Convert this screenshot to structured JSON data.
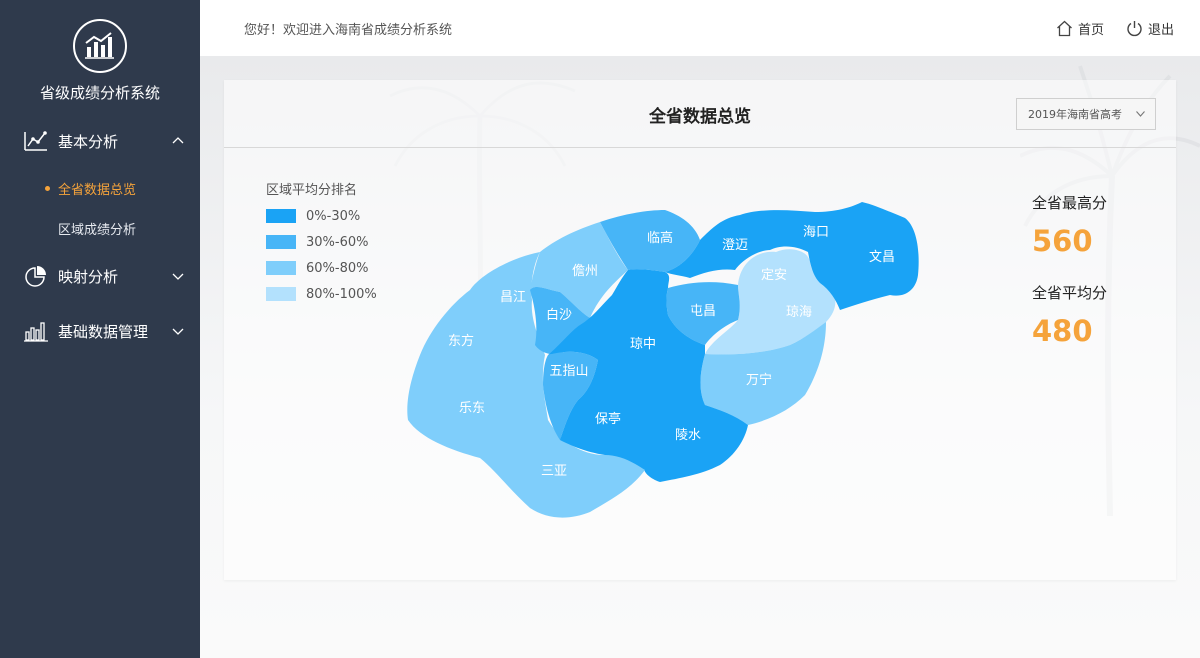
{
  "app": {
    "title": "省级成绩分析系统"
  },
  "sidebar": {
    "menus": [
      {
        "label": "基本分析",
        "icon": "line-chart-icon",
        "expanded": true,
        "children": [
          {
            "label": "全省数据总览",
            "active": true
          },
          {
            "label": "区域成绩分析",
            "active": false
          }
        ]
      },
      {
        "label": "映射分析",
        "icon": "pie-chart-icon",
        "expanded": false
      },
      {
        "label": "基础数据管理",
        "icon": "bar-chart-icon",
        "expanded": false
      }
    ]
  },
  "header": {
    "welcome": "您好！欢迎进入海南省成绩分析系统",
    "home": "首页",
    "logout": "退出"
  },
  "overview": {
    "title": "全省数据总览",
    "exam_select": "2019年海南省高考",
    "legend": {
      "title": "区域平均分排名",
      "items": [
        {
          "label": "0%-30%",
          "color": "#1aa3f5"
        },
        {
          "label": "30%-60%",
          "color": "#47b5f7"
        },
        {
          "label": "60%-80%",
          "color": "#7fcefb"
        },
        {
          "label": "80%-100%",
          "color": "#b3e1fd"
        }
      ]
    },
    "regions": {
      "lingao": "临高",
      "chengmai": "澄迈",
      "haikou": "海口",
      "wenchang": "文昌",
      "danzhou": "儋州",
      "dingan": "定安",
      "changjiang": "昌江",
      "baisha": "白沙",
      "tunchang": "屯昌",
      "qionghai": "琼海",
      "dongfang": "东方",
      "qiongzhong": "琼中",
      "wuzhishan": "五指山",
      "wanning": "万宁",
      "ledong": "乐东",
      "baoting": "保亭",
      "lingshui": "陵水",
      "sanya": "三亚"
    },
    "stats": {
      "max_label": "全省最高分",
      "max_value": "560",
      "avg_label": "全省平均分",
      "avg_value": "480"
    },
    "accent_color": "#f5a33b"
  }
}
